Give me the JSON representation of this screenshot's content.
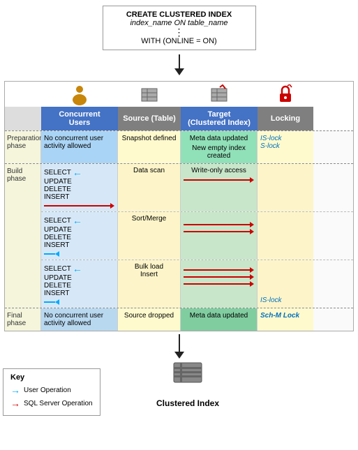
{
  "sql_box": {
    "line1": "CREATE CLUSTERED INDEX",
    "line2": "index_name ON table_name",
    "dots": "⋮",
    "line3": "WITH (ONLINE = ON)"
  },
  "headers": {
    "phase_label": "",
    "concurrent": "Concurrent\nUsers",
    "source": "Source (Table)",
    "target": "Target\n(Clustered Index)",
    "locking": "Locking"
  },
  "preparation": {
    "phase_label": "Preparation phase",
    "concurrent_text": "No concurrent user activity allowed",
    "source_text": "Snapshot defined",
    "target_line1": "Meta data updated",
    "target_line2": "New empty index created",
    "locking_line1": "IS-lock",
    "locking_line2": "S-lock"
  },
  "build": {
    "phase_label": "Build phase",
    "rows": [
      {
        "concurrent_ops": [
          "SELECT",
          "UPDATE",
          "DELETE",
          "INSERT"
        ],
        "source_text": "Data scan",
        "target_text": "Write-only access",
        "locking_text": ""
      },
      {
        "concurrent_ops": [
          "SELECT",
          "UPDATE",
          "DELETE",
          "INSERT"
        ],
        "source_text": "Sort/Merge",
        "target_text": "",
        "locking_text": ""
      },
      {
        "concurrent_ops": [
          "SELECT",
          "UPDATE",
          "DELETE",
          "INSERT"
        ],
        "source_text": "Bulk load\nInsert",
        "target_text": "",
        "locking_text": "IS-lock"
      }
    ]
  },
  "final": {
    "phase_label": "Final phase",
    "concurrent_text": "No concurrent user activity allowed",
    "source_text": "Source dropped",
    "target_text": "Meta data updated",
    "locking_text": "Sch-M Lock"
  },
  "key": {
    "title": "Key",
    "item1": "User Operation",
    "item2": "SQL Server Operation"
  },
  "bottom": {
    "clustered_index_label": "Clustered Index"
  }
}
